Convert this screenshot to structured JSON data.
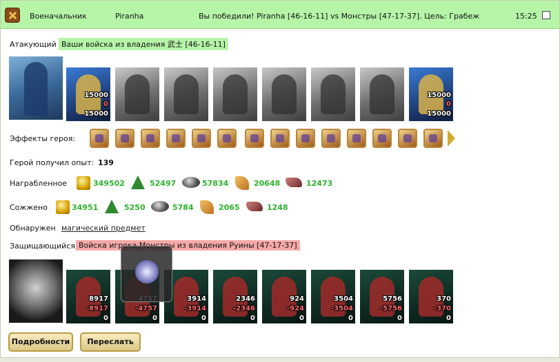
{
  "header": {
    "title": "Военачальник",
    "player": "Piranha",
    "result": "Вы победили! Piranha [46-16-11] vs Монстры [47-17-37]. Цель: Грабеж",
    "time": "15:25"
  },
  "attacker": {
    "label": "Атакующий",
    "tag": "Ваши войска из владения 武士 [46-16-11]",
    "units": [
      {
        "name": "knight-hero",
        "top": "15000",
        "mid": "0",
        "bottom": "15000",
        "style": "color"
      },
      {
        "name": "gray-unit-1",
        "style": "gray"
      },
      {
        "name": "gray-unit-2",
        "style": "gray"
      },
      {
        "name": "gray-unit-3",
        "style": "gray"
      },
      {
        "name": "gray-unit-4",
        "style": "gray"
      },
      {
        "name": "gray-unit-5",
        "style": "gray"
      },
      {
        "name": "gray-unit-6",
        "style": "gray"
      },
      {
        "name": "mage-unit",
        "top": "15000",
        "mid": "0",
        "bottom": "15000",
        "style": "color"
      }
    ]
  },
  "effects": {
    "label": "Эффекты героя:",
    "count": 13
  },
  "experience": {
    "label": "Герой получил опыт:",
    "value": "139"
  },
  "looted": {
    "label": "Награбленное",
    "gold": "349502",
    "wood": "52497",
    "ore": "57834",
    "sulfur": "20648",
    "crystal": "12473"
  },
  "burned": {
    "label": "Сожжено",
    "gold": "34951",
    "wood": "5250",
    "ore": "5784",
    "sulfur": "2065",
    "crystal": "1248"
  },
  "found": {
    "label": "Обнаружен",
    "item": "магический предмет"
  },
  "defender": {
    "label": "Защищающийся",
    "tag": "Войска игрока Монстры из владения Руины [47-17-37]",
    "units": [
      {
        "top": "8917",
        "mid": "-8917",
        "bottom": "0"
      },
      {
        "top": "4757",
        "mid": "-4757",
        "bottom": "0"
      },
      {
        "top": "3914",
        "mid": "-3914",
        "bottom": "0"
      },
      {
        "top": "2346",
        "mid": "-2346",
        "bottom": "0"
      },
      {
        "top": "924",
        "mid": "-924",
        "bottom": "0"
      },
      {
        "top": "3504",
        "mid": "-3504",
        "bottom": "0"
      },
      {
        "top": "5756",
        "mid": "-5756",
        "bottom": "0"
      },
      {
        "top": "370",
        "mid": "-370",
        "bottom": "0"
      }
    ]
  },
  "buttons": {
    "details": "Подробности",
    "forward": "Переслать"
  }
}
